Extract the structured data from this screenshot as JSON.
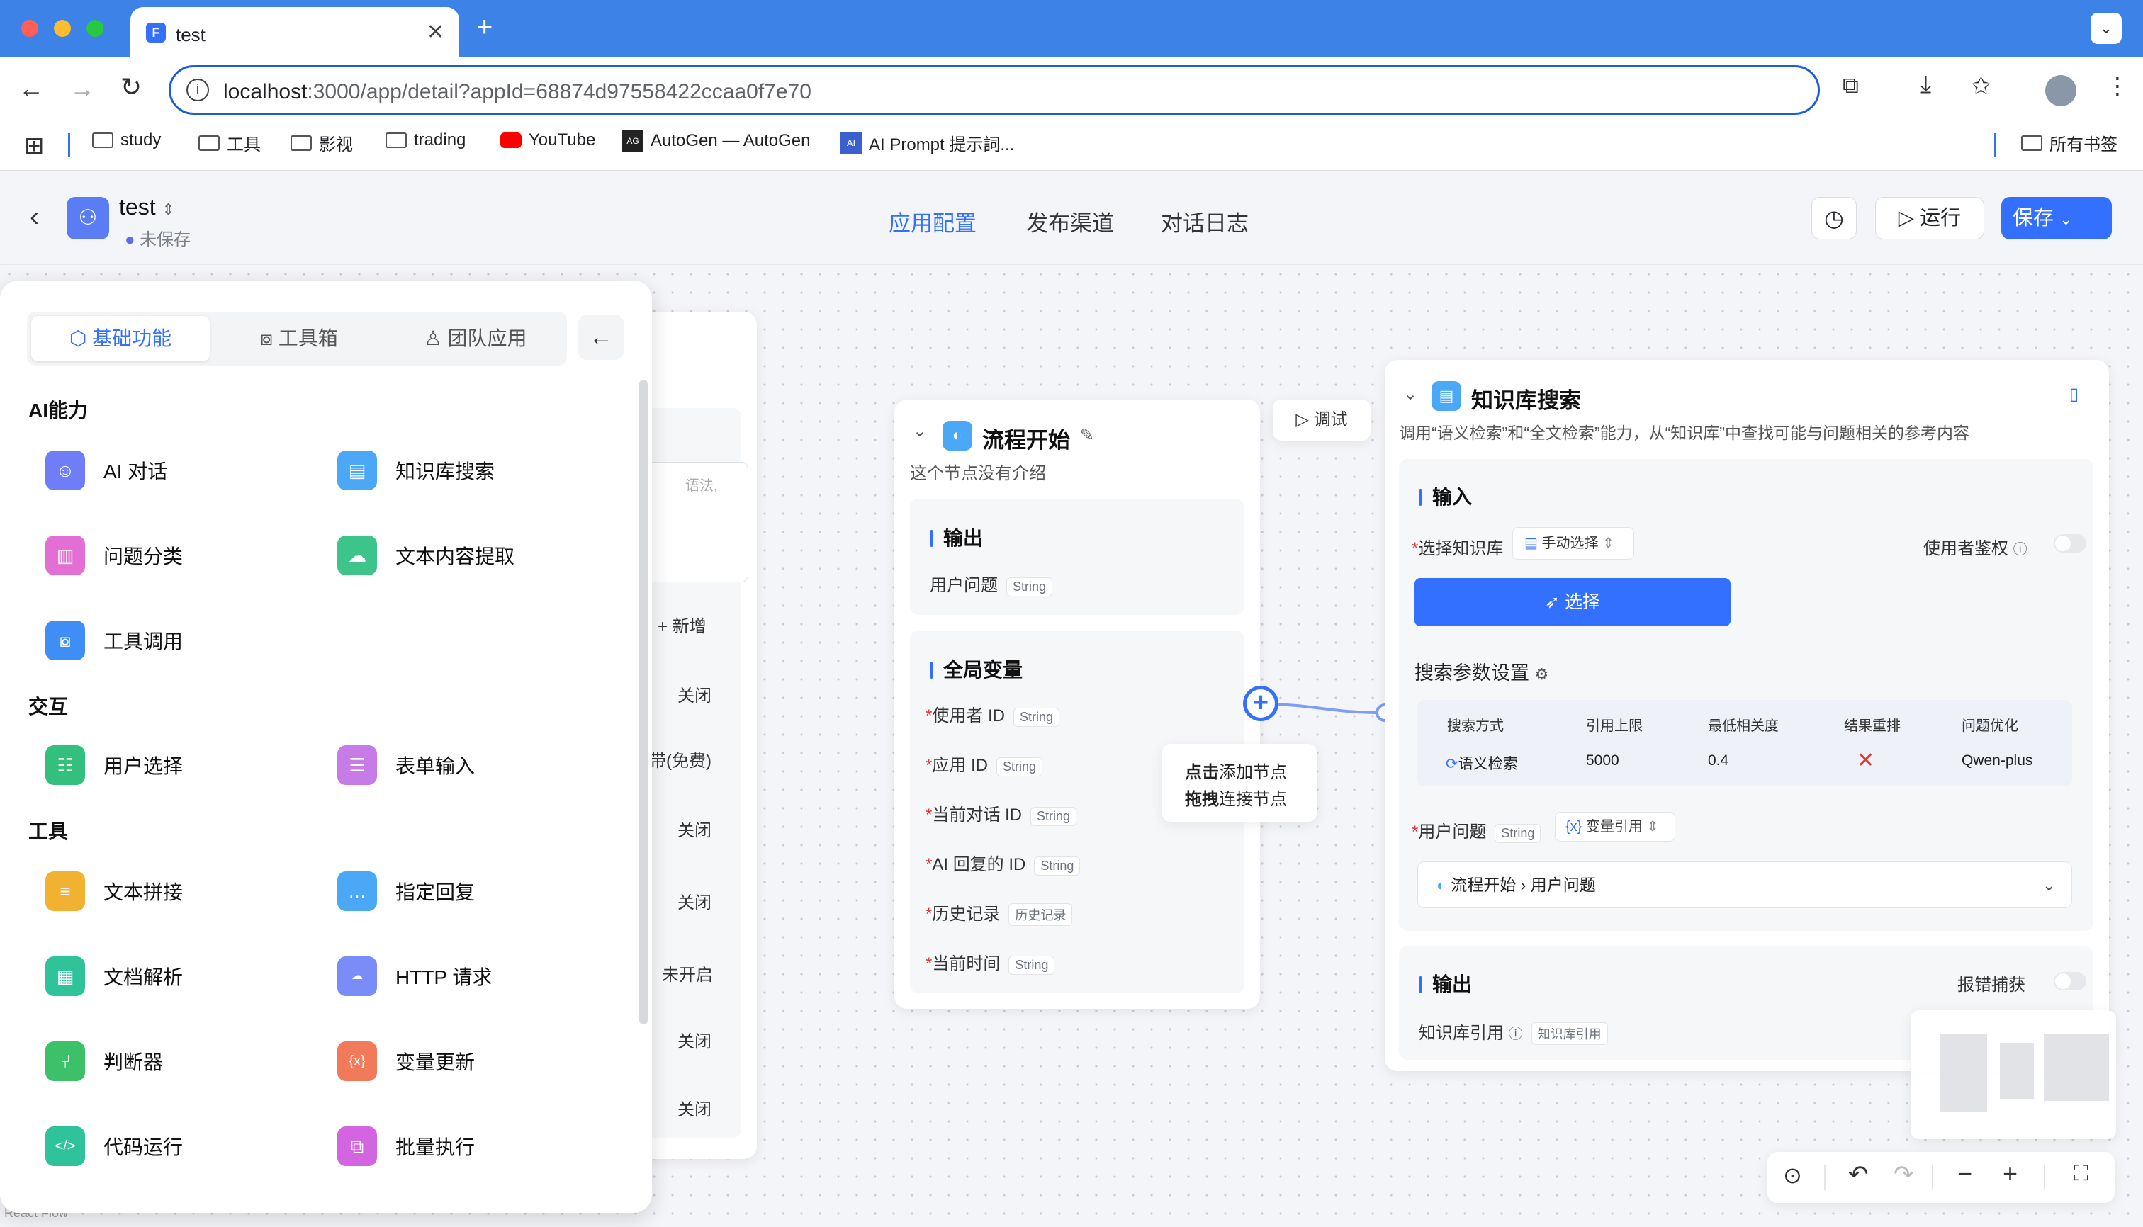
{
  "browser": {
    "tab_title": "test",
    "url_host": "localhost",
    "url_rest": ":3000/app/detail?appId=68874d97558422ccaa0f7e70",
    "bookmarks": [
      "study",
      "工具",
      "影视",
      "trading",
      "YouTube",
      "AutoGen — AutoGen",
      "AI Prompt 提示詞..."
    ],
    "all_bookmarks": "所有书签"
  },
  "app": {
    "name": "test",
    "status": "未保存",
    "tabs": [
      "应用配置",
      "发布渠道",
      "对话日志"
    ],
    "run_label": "运行",
    "save_label": "保存"
  },
  "panel": {
    "tabs": [
      "基础功能",
      "工具箱",
      "团队应用"
    ],
    "groups": [
      {
        "title": "AI能力",
        "items": [
          "AI 对话",
          "知识库搜索",
          "问题分类",
          "文本内容提取",
          "工具调用"
        ]
      },
      {
        "title": "交互",
        "items": [
          "用户选择",
          "表单输入"
        ]
      },
      {
        "title": "工具",
        "items": [
          "文本拼接",
          "指定回复",
          "文档解析",
          "HTTP 请求",
          "判断器",
          "变量更新",
          "代码运行",
          "批量执行"
        ]
      }
    ]
  },
  "bg_node": {
    "placeholder_frag": "语法,",
    "add_label": "+ 新增",
    "rows": [
      "关闭",
      "带(免费)",
      "关闭",
      "关闭",
      "未开启",
      "关闭",
      "关闭"
    ]
  },
  "start_node": {
    "title": "流程开始",
    "desc": "这个节点没有介绍",
    "debug": "调试",
    "output_title": "输出",
    "output_field": "用户问题",
    "output_type": "String",
    "globals_title": "全局变量",
    "globals": [
      {
        "name": "使用者 ID",
        "type": "String"
      },
      {
        "name": "应用 ID",
        "type": "String"
      },
      {
        "name": "当前对话 ID",
        "type": "String"
      },
      {
        "name": "AI 回复的 ID",
        "type": "String"
      },
      {
        "name": "历史记录",
        "type": "历史记录"
      },
      {
        "name": "当前时间",
        "type": "String"
      }
    ]
  },
  "tooltip": {
    "line1_a": "点击",
    "line1_b": "添加节点",
    "line2_a": "拖拽",
    "line2_b": "连接节点"
  },
  "kb_node": {
    "title": "知识库搜索",
    "desc": "调用“语义检索”和“全文检索”能力，从“知识库”中查找可能与问题相关的参考内容",
    "input_title": "输入",
    "select_kb": "选择知识库",
    "manual_select": "手动选择",
    "user_auth": "使用者鉴权",
    "select_btn": "选择",
    "search_params": "搜索参数设置",
    "table_headers": [
      "搜索方式",
      "引用上限",
      "最低相关度",
      "结果重排",
      "问题优化"
    ],
    "table_values": [
      "语义检索",
      "5000",
      "0.4",
      "✕",
      "Qwen-plus"
    ],
    "user_question": "用户问题",
    "uq_type": "String",
    "var_ref": "变量引用",
    "ref_path_a": "流程开始",
    "ref_path_b": "用户问题",
    "output_title": "输出",
    "error_catch": "报错捕获",
    "kb_ref": "知识库引用",
    "kb_ref_type": "知识库引用"
  },
  "watermark": "React Flow"
}
